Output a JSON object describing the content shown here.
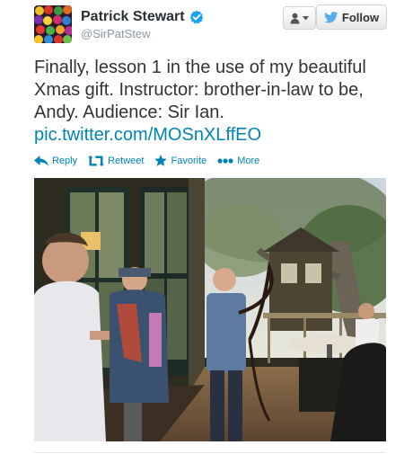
{
  "user": {
    "fullname": "Patrick Stewart",
    "username": "@SirPatStew",
    "verified": true
  },
  "buttons": {
    "follow_label": "Follow"
  },
  "tweet": {
    "text_lines": [
      "Finally, lesson 1 in the use of my beautiful",
      "Xmas gift. Instructor: brother-in-law to be,",
      "Andy. Audience: Sir Ian."
    ],
    "link": "pic.twitter.com/MOSnXLffEO"
  },
  "actions": {
    "reply": "Reply",
    "retweet": "Retweet",
    "favorite": "Favorite",
    "more": "More"
  },
  "icons": {
    "avatar": "colorful-balls-avatar",
    "verified": "verified-badge-icon",
    "user": "person-icon",
    "dropdown": "caret-down-icon",
    "follow": "twitter-bird-icon",
    "reply": "reply-arrow-icon",
    "retweet": "retweet-icon",
    "favorite": "star-icon",
    "more": "ellipsis-icon"
  },
  "colors": {
    "link": "#0084b4",
    "verified": "#1da1f2",
    "twitter_blue": "#55acee",
    "text": "#333333"
  }
}
